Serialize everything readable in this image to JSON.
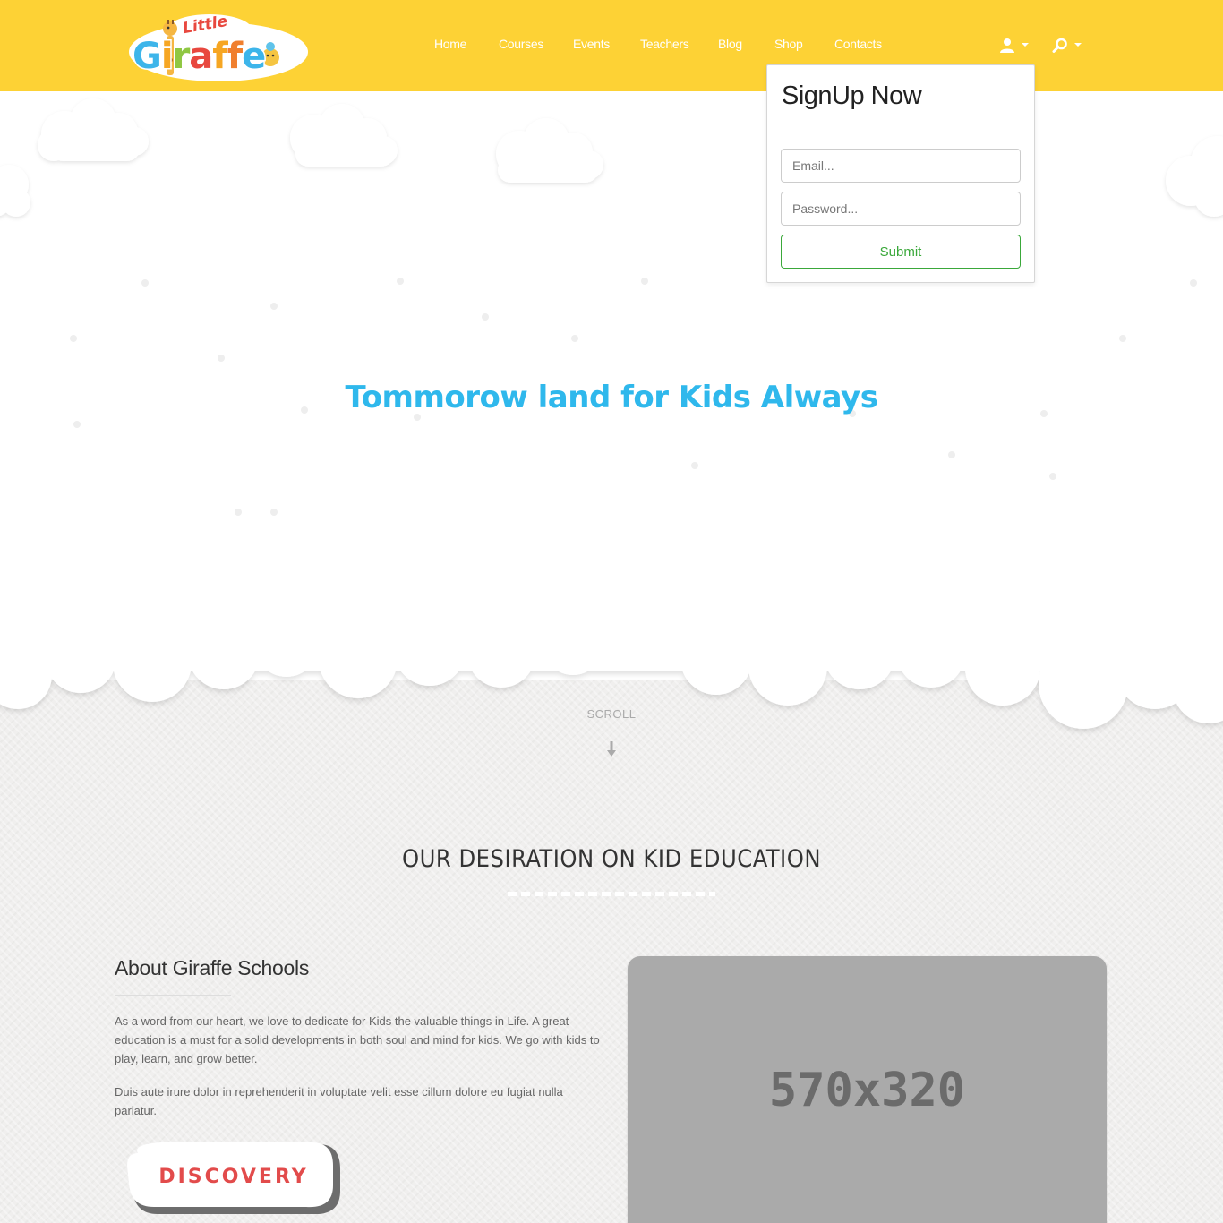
{
  "brand": {
    "logo_small": "Little",
    "logo_main": [
      "G",
      "i",
      "r",
      "a",
      "f",
      "f",
      "e"
    ]
  },
  "nav": {
    "items": [
      {
        "label": "Home"
      },
      {
        "label": "Courses"
      },
      {
        "label": "Events"
      },
      {
        "label": "Teachers"
      },
      {
        "label": "Blog"
      },
      {
        "label": "Shop"
      },
      {
        "label": "Contacts"
      }
    ],
    "user_icon": "user-icon",
    "search_icon": "search-icon"
  },
  "signup": {
    "title": "SignUp Now",
    "email_placeholder": "Email...",
    "password_placeholder": "Password...",
    "submit_label": "Submit"
  },
  "hero": {
    "title": "Tommorow land for Kids Always"
  },
  "scroll": {
    "label": "SCROLL",
    "icon": "arrow-down-icon"
  },
  "section": {
    "title": "OUR DESIRATION ON KID EDUCATION"
  },
  "about": {
    "title": "About Giraffe Schools",
    "paragraph1": "As a word from our heart, we love to dedicate for Kids the valuable things in Life. A great education is a must for a solid developments in both soul and mind for kids. We go with kids to play, learn, and grow better.",
    "paragraph2": "Duis aute irure dolor in reprehenderit in voluptate velit esse cillum dolore eu fugiat nulla pariatur.",
    "button_label": "DISCOVERY"
  },
  "media": {
    "placeholder_label": "570x320"
  },
  "colors": {
    "header": "#fdd235",
    "hero_title": "#2fb8ec",
    "submit_green": "#3aa83a",
    "discovery_red": "#e24b4b",
    "placeholder_gray": "#aaaaaa"
  }
}
